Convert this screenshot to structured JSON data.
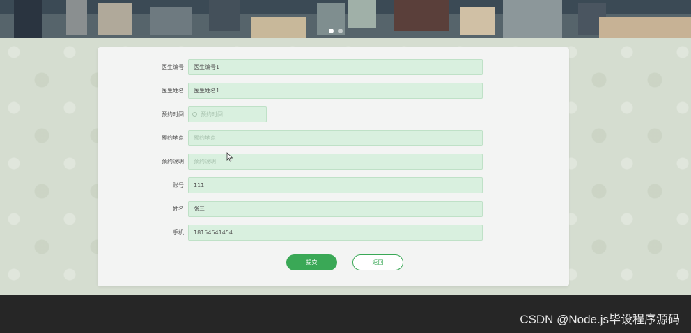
{
  "banner": {
    "slide_count": 2,
    "active_slide": 1
  },
  "form": {
    "fields": [
      {
        "label": "医生编号",
        "value": "医生编号1",
        "placeholder": ""
      },
      {
        "label": "医生姓名",
        "value": "医生姓名1",
        "placeholder": ""
      },
      {
        "label": "预约时间",
        "value": "",
        "placeholder": "预约时间"
      },
      {
        "label": "预约地点",
        "value": "",
        "placeholder": "预约地点"
      },
      {
        "label": "预约说明",
        "value": "",
        "placeholder": "预约说明"
      },
      {
        "label": "账号",
        "value": "111",
        "placeholder": ""
      },
      {
        "label": "姓名",
        "value": "张三",
        "placeholder": ""
      },
      {
        "label": "手机",
        "value": "18154541454",
        "placeholder": ""
      }
    ],
    "submit_label": "提交",
    "back_label": "返回"
  },
  "footer": {
    "watermark": "CSDN @Node.js毕设程序源码"
  },
  "colors": {
    "accent": "#3aa856",
    "input_bg": "#d9f0df",
    "card_bg": "#f3f4f3",
    "footer_bg": "#262626"
  },
  "icons": {
    "date_field": "clock-icon",
    "pointer": "mouse-cursor-icon"
  }
}
